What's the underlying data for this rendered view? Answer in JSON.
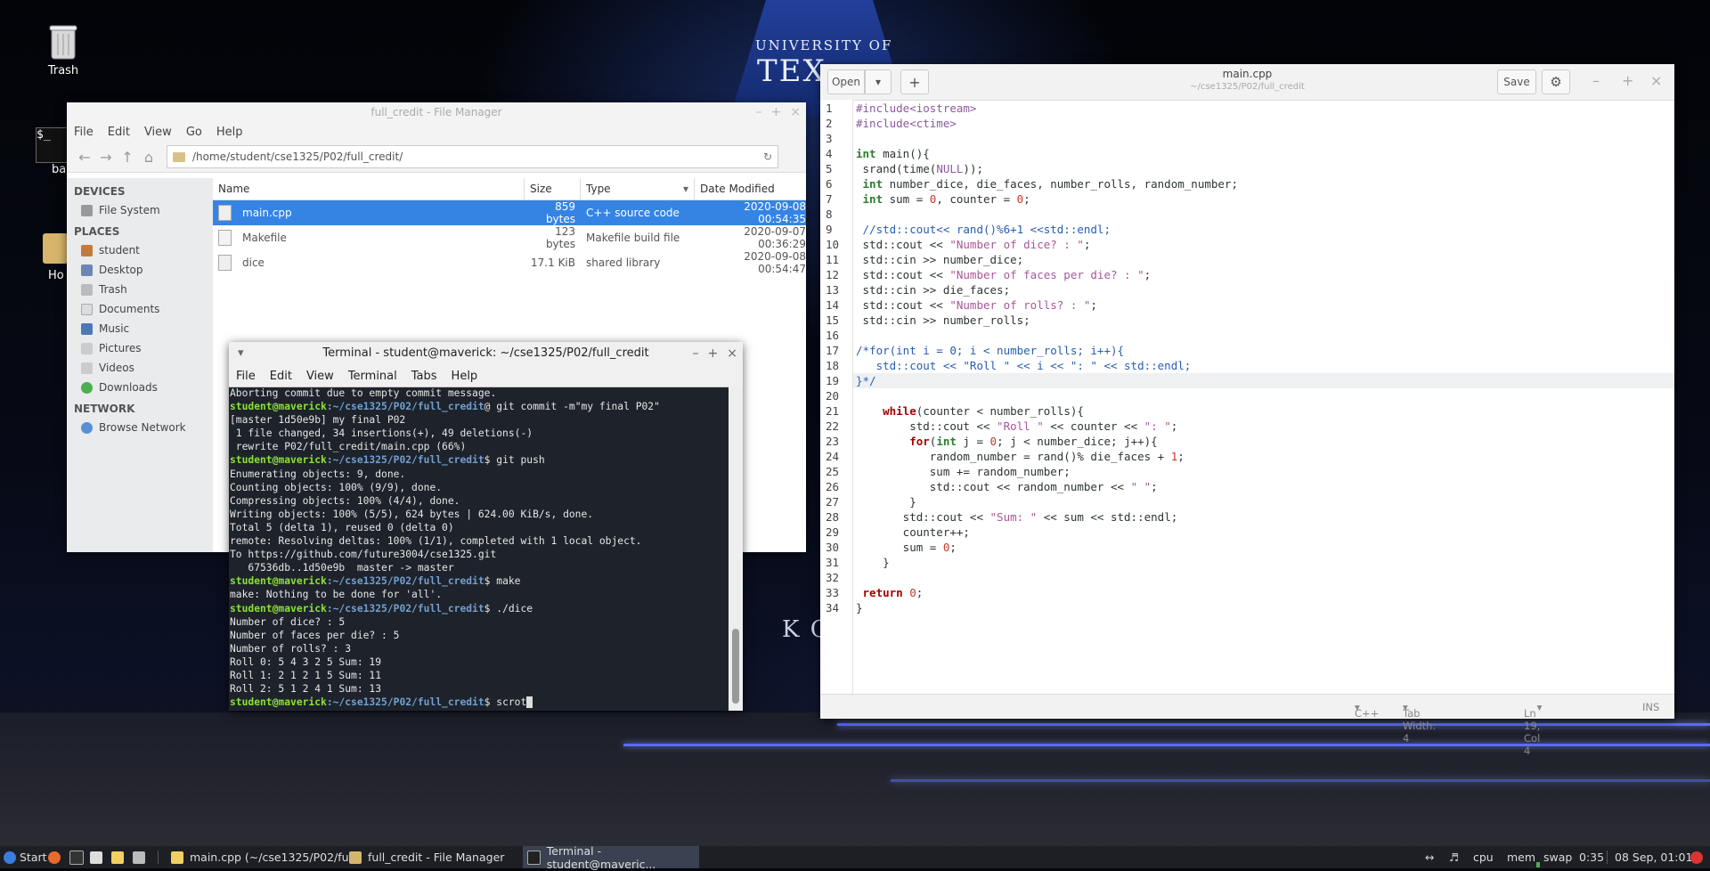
{
  "desktop": {
    "icons": [
      {
        "label": "Trash"
      },
      {
        "label": "ba"
      },
      {
        "label": "Ho"
      }
    ],
    "background_text": {
      "line1": "UNIVERSITY OF",
      "line2": "TEX",
      "sign": "K CENT"
    }
  },
  "file_manager": {
    "title": "full_credit - File Manager",
    "menu": [
      "File",
      "Edit",
      "View",
      "Go",
      "Help"
    ],
    "path": "/home/student/cse1325/P02/full_credit/",
    "sidebar": {
      "devices_label": "DEVICES",
      "devices": [
        "File System"
      ],
      "places_label": "PLACES",
      "places": [
        "student",
        "Desktop",
        "Trash",
        "Documents",
        "Music",
        "Pictures",
        "Videos",
        "Downloads"
      ],
      "network_label": "NETWORK",
      "network": [
        "Browse Network"
      ]
    },
    "columns": [
      "Name",
      "Size",
      "Type",
      "Date Modified"
    ],
    "files": [
      {
        "name": "main.cpp",
        "size": "859 bytes",
        "type": "C++ source code",
        "date": "2020-09-08 00:54:35"
      },
      {
        "name": "Makefile",
        "size": "123 bytes",
        "type": "Makefile build file",
        "date": "2020-09-07 00:36:29"
      },
      {
        "name": "dice",
        "size": "17.1 KiB",
        "type": "shared library",
        "date": "2020-09-08 00:54:47"
      }
    ]
  },
  "terminal": {
    "title": "Terminal - student@maverick: ~/cse1325/P02/full_credit",
    "menu": [
      "File",
      "Edit",
      "View",
      "Terminal",
      "Tabs",
      "Help"
    ],
    "prompt_user": "student@maverick",
    "prompt_path": ":~/cse1325/P02/full_credit",
    "lines": [
      {
        "text": "Aborting commit due to empty commit message."
      },
      {
        "prompt": true,
        "text": "@ git commit -m\"my final P02\""
      },
      {
        "text": "[master 1d50e9b] my final P02"
      },
      {
        "text": " 1 file changed, 34 insertions(+), 49 deletions(-)"
      },
      {
        "text": " rewrite P02/full_credit/main.cpp (66%)"
      },
      {
        "prompt": true,
        "text": "$ git push"
      },
      {
        "text": "Enumerating objects: 9, done."
      },
      {
        "text": "Counting objects: 100% (9/9), done."
      },
      {
        "text": "Compressing objects: 100% (4/4), done."
      },
      {
        "text": "Writing objects: 100% (5/5), 624 bytes | 624.00 KiB/s, done."
      },
      {
        "text": "Total 5 (delta 1), reused 0 (delta 0)"
      },
      {
        "text": "remote: Resolving deltas: 100% (1/1), completed with 1 local object."
      },
      {
        "text": "To https://github.com/future3004/cse1325.git"
      },
      {
        "text": "   67536db..1d50e9b  master -> master"
      },
      {
        "prompt": true,
        "text": "$ make"
      },
      {
        "text": "make: Nothing to be done for 'all'."
      },
      {
        "prompt": true,
        "text": "$ ./dice"
      },
      {
        "text": "Number of dice? : 5"
      },
      {
        "text": "Number of faces per die? : 5"
      },
      {
        "text": "Number of rolls? : 3"
      },
      {
        "text": "Roll 0: 5 4 3 2 5 Sum: 19"
      },
      {
        "text": "Roll 1: 2 1 2 1 5 Sum: 11"
      },
      {
        "text": "Roll 2: 5 1 2 4 1 Sum: 13"
      },
      {
        "prompt": true,
        "text": "$ scrot",
        "cursor": true
      }
    ]
  },
  "editor": {
    "title": "main.cpp",
    "subtitle": "~/cse1325/P02/full_credit",
    "open_label": "Open",
    "save_label": "Save",
    "current_line": 19,
    "code": [
      [
        [
          "pre",
          "#include<iostream>"
        ]
      ],
      [
        [
          "pre",
          "#include<ctime>"
        ]
      ],
      [],
      [
        [
          "ty",
          "int"
        ],
        [
          "t",
          " main(){"
        ]
      ],
      [
        [
          "t",
          " srand(time("
        ],
        [
          "pre",
          "NULL"
        ],
        [
          "t",
          "));"
        ]
      ],
      [
        [
          "t",
          " "
        ],
        [
          "ty",
          "int"
        ],
        [
          "t",
          " number_dice, die_faces, number_rolls, random_number;"
        ]
      ],
      [
        [
          "t",
          " "
        ],
        [
          "ty",
          "int"
        ],
        [
          "t",
          " sum = "
        ],
        [
          "nu",
          "0"
        ],
        [
          "t",
          ", counter = "
        ],
        [
          "nu",
          "0"
        ],
        [
          "t",
          ";"
        ]
      ],
      [],
      [
        [
          "cm",
          " //std::cout<< rand()%6+1 <<std::endl;"
        ]
      ],
      [
        [
          "t",
          " std::cout << "
        ],
        [
          "st",
          "\"Number of dice? : \""
        ],
        [
          "t",
          ";"
        ]
      ],
      [
        [
          "t",
          " std::cin >> number_dice;"
        ]
      ],
      [
        [
          "t",
          " std::cout << "
        ],
        [
          "st",
          "\"Number of faces per die? : \""
        ],
        [
          "t",
          ";"
        ]
      ],
      [
        [
          "t",
          " std::cin >> die_faces;"
        ]
      ],
      [
        [
          "t",
          " std::cout << "
        ],
        [
          "st",
          "\"Number of rolls? : \""
        ],
        [
          "t",
          ";"
        ]
      ],
      [
        [
          "t",
          " std::cin >> number_rolls;"
        ]
      ],
      [],
      [
        [
          "cm",
          "/*for(int i = 0; i < number_rolls; i++){"
        ]
      ],
      [
        [
          "cm",
          "   std::cout << \"Roll \" << i << \": \" << std::endl;"
        ]
      ],
      [
        [
          "cm",
          "}*/"
        ]
      ],
      [],
      [
        [
          "t",
          "    "
        ],
        [
          "kw",
          "while"
        ],
        [
          "t",
          "(counter < number_rolls){"
        ]
      ],
      [
        [
          "t",
          "        std::cout << "
        ],
        [
          "st",
          "\"Roll \""
        ],
        [
          "t",
          " << counter << "
        ],
        [
          "st",
          "\": \""
        ],
        [
          "t",
          ";"
        ]
      ],
      [
        [
          "t",
          "        "
        ],
        [
          "kw",
          "for"
        ],
        [
          "t",
          "("
        ],
        [
          "ty",
          "int"
        ],
        [
          "t",
          " j = "
        ],
        [
          "nu",
          "0"
        ],
        [
          "t",
          "; j < number_dice; j++){"
        ]
      ],
      [
        [
          "t",
          "           random_number = rand()% die_faces + "
        ],
        [
          "nu",
          "1"
        ],
        [
          "t",
          ";"
        ]
      ],
      [
        [
          "t",
          "           sum += random_number;"
        ]
      ],
      [
        [
          "t",
          "           std::cout << random_number << "
        ],
        [
          "st",
          "\" \""
        ],
        [
          "t",
          ";"
        ]
      ],
      [
        [
          "t",
          "        }"
        ]
      ],
      [
        [
          "t",
          "       std::cout << "
        ],
        [
          "st",
          "\"Sum: \""
        ],
        [
          "t",
          " << sum << std::endl;"
        ]
      ],
      [
        [
          "t",
          "       counter++;"
        ]
      ],
      [
        [
          "t",
          "       sum = "
        ],
        [
          "nu",
          "0"
        ],
        [
          "t",
          ";"
        ]
      ],
      [
        [
          "t",
          "    }"
        ]
      ],
      [],
      [
        [
          "t",
          " "
        ],
        [
          "kw",
          "return"
        ],
        [
          "t",
          " "
        ],
        [
          "nu",
          "0"
        ],
        [
          "t",
          ";"
        ]
      ],
      [
        [
          "t",
          "}"
        ]
      ]
    ],
    "status": {
      "language": "C++",
      "tab_width": "Tab Width: 4",
      "position": "Ln 19, Col 4",
      "mode": "INS"
    }
  },
  "taskbar": {
    "start_label": "Start",
    "tasks": [
      {
        "label": "main.cpp (~/cse1325/P02/fu..."
      },
      {
        "label": "full_credit - File Manager"
      },
      {
        "label": "Terminal - student@maveric..."
      }
    ],
    "cpu_label": "cpu",
    "mem_label": "mem",
    "swap_label": "swap",
    "time_elapsed": "0:35",
    "datetime": "08 Sep, 01:01"
  }
}
